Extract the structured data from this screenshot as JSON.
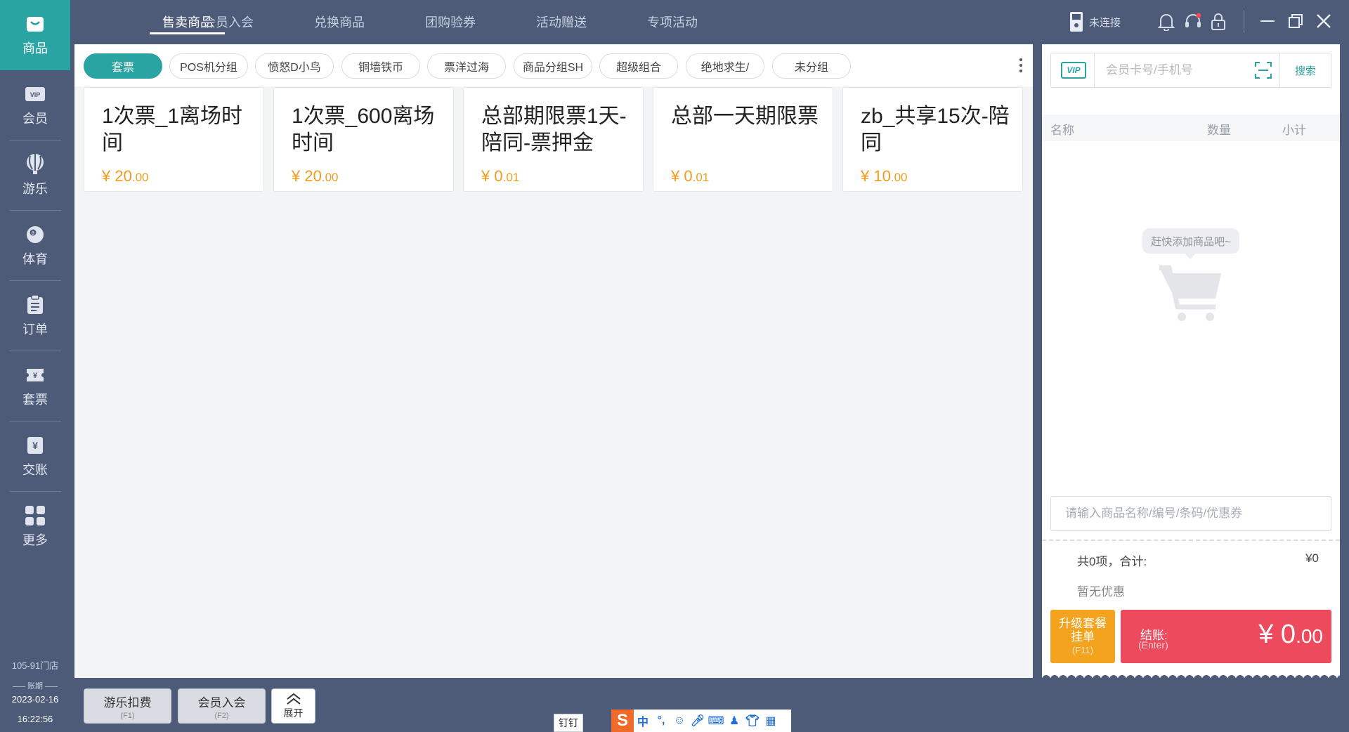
{
  "sidebar": {
    "items": [
      {
        "label": "商品",
        "icon": "shopping-bag-icon",
        "active": true
      },
      {
        "label": "会员",
        "icon": "vip-card-icon"
      },
      {
        "label": "游乐",
        "icon": "balloon-icon"
      },
      {
        "label": "体育",
        "icon": "billiard-ball-icon"
      },
      {
        "label": "订单",
        "icon": "clipboard-icon"
      },
      {
        "label": "套票",
        "icon": "ticket-icon"
      },
      {
        "label": "交账",
        "icon": "yuan-receipt-icon"
      },
      {
        "label": "更多",
        "icon": "grid-icon"
      }
    ],
    "store": "105-91门店",
    "period_label": "账期",
    "date": "2023-02-16",
    "time": "16:22:56"
  },
  "topbar": {
    "tabs": [
      "售卖商品",
      "会员入会",
      "兑换商品",
      "团购验券",
      "活动赠送",
      "专项活动"
    ],
    "device_status": "未连接"
  },
  "categories": [
    "套票",
    "POS机分组",
    "愤怒D小鸟",
    "铜墙铁币",
    "票洋过海",
    "商品分组SH",
    "超级组合",
    "绝地求生/",
    "未分组"
  ],
  "products": [
    {
      "name": "1次票_1离场时间",
      "price_int": "20",
      "price_dec": ".00"
    },
    {
      "name": "1次票_600离场时间",
      "price_int": "20",
      "price_dec": ".00"
    },
    {
      "name": "总部期限票1天-陪同-票押金",
      "price_int": "0",
      "price_dec": ".01"
    },
    {
      "name": "总部一天期限票",
      "price_int": "0",
      "price_dec": ".01"
    },
    {
      "name": "zb_共享15次-陪同",
      "price_int": "10",
      "price_dec": ".00"
    }
  ],
  "currency": "¥",
  "cart": {
    "vip_badge": "VIP",
    "member_placeholder": "会员卡号/手机号",
    "search_label": "搜索",
    "col_name": "名称",
    "col_qty": "数量",
    "col_subtotal": "小计",
    "empty_text": "赶快添加商品吧~",
    "goods_placeholder": "请输入商品名称/编号/条码/优惠券",
    "total_label": "共0项，合计:",
    "total_value": "¥0",
    "discount_text": "暂无优惠",
    "hang_line1": "升级套餐",
    "hang_line2": "挂单",
    "hang_key": "(F11)",
    "pay_label": "结账:",
    "pay_key": "(Enter)",
    "pay_currency": "¥",
    "pay_int": "0",
    "pay_dec": ".00"
  },
  "bottom": {
    "btn1": "游乐扣费",
    "btn1_key": "(F1)",
    "btn2": "会员入会",
    "btn2_key": "(F2)",
    "expand": "展开"
  },
  "taskbar": {
    "dingding": "钉钉",
    "ime_logo": "S",
    "ime_mode": "中",
    "ime_punct": "°,"
  },
  "colors": {
    "accent": "#2aa3a3",
    "price": "#f29b1c",
    "pay": "#ee4a5d",
    "hang": "#f4a31f",
    "chrome": "#4d5b79"
  }
}
